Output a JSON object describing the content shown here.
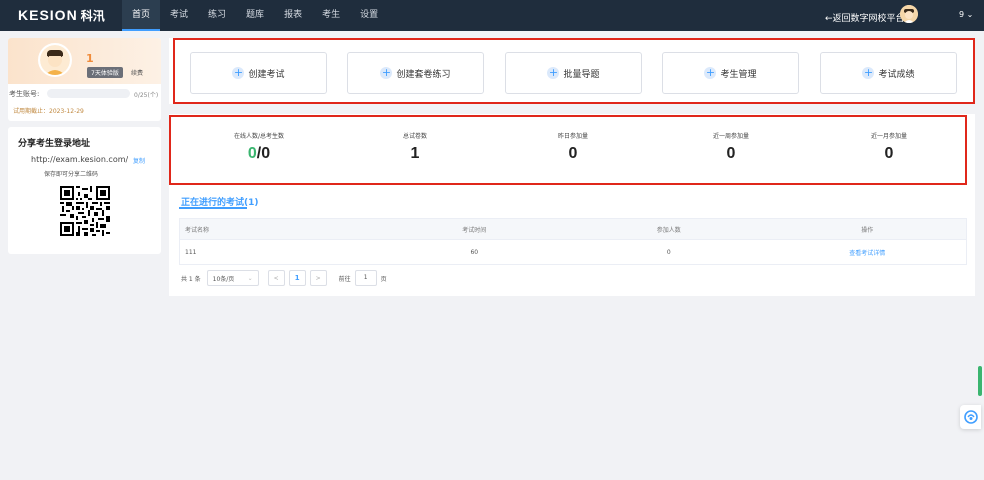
{
  "header": {
    "logo_text": "KESION",
    "logo_cn": "科汛",
    "nav": [
      "首页",
      "考试",
      "练习",
      "题库",
      "报表",
      "考生",
      "设置"
    ],
    "back_link": "←返回数字网校平台",
    "user": "9 ⌄"
  },
  "profile": {
    "name": "1",
    "badge": "7天体验版",
    "renew": "续费",
    "account_label": "考生账号:",
    "account_count": "0/25(个)",
    "account_fill": 0,
    "expire": "试用期截止：2023-12-29"
  },
  "share": {
    "title": "分享考生登录地址",
    "url": "http://exam.kesion.com/c",
    "copy": "复制",
    "hint": "保存即可分享二维码"
  },
  "actions": [
    {
      "label": "创建考试"
    },
    {
      "label": "创建套卷练习"
    },
    {
      "label": "批量导题"
    },
    {
      "label": "考生管理"
    },
    {
      "label": "考试成绩"
    }
  ],
  "stats": {
    "online": {
      "label": "在线人数/总考生数",
      "online": "0",
      "total": "/0"
    },
    "total_exams": {
      "label": "总试卷数",
      "value": "1"
    },
    "yesterday": {
      "label": "昨日参加量",
      "value": "0"
    },
    "week": {
      "label": "近一周参加量",
      "value": "0"
    },
    "month": {
      "label": "近一月参加量",
      "value": "0"
    }
  },
  "running": {
    "title": "正在进行的考试(1)",
    "columns": [
      "考试名称",
      "考试时间",
      "参加人数",
      "操作"
    ],
    "rows": [
      {
        "name": "111",
        "time": "60",
        "count": "0",
        "action": "查看考试详情"
      }
    ]
  },
  "pagination": {
    "total": "共 1 条",
    "page_size": "10条/页",
    "prev": "<",
    "current": "1",
    "next": ">",
    "goto_label": "前往",
    "goto_value": "1",
    "goto_unit": "页"
  },
  "colors": {
    "topbar": "#1f2d3d",
    "accent": "#409eff",
    "highlight_frame": "#e0271a",
    "online_green": "#3ab56f"
  }
}
